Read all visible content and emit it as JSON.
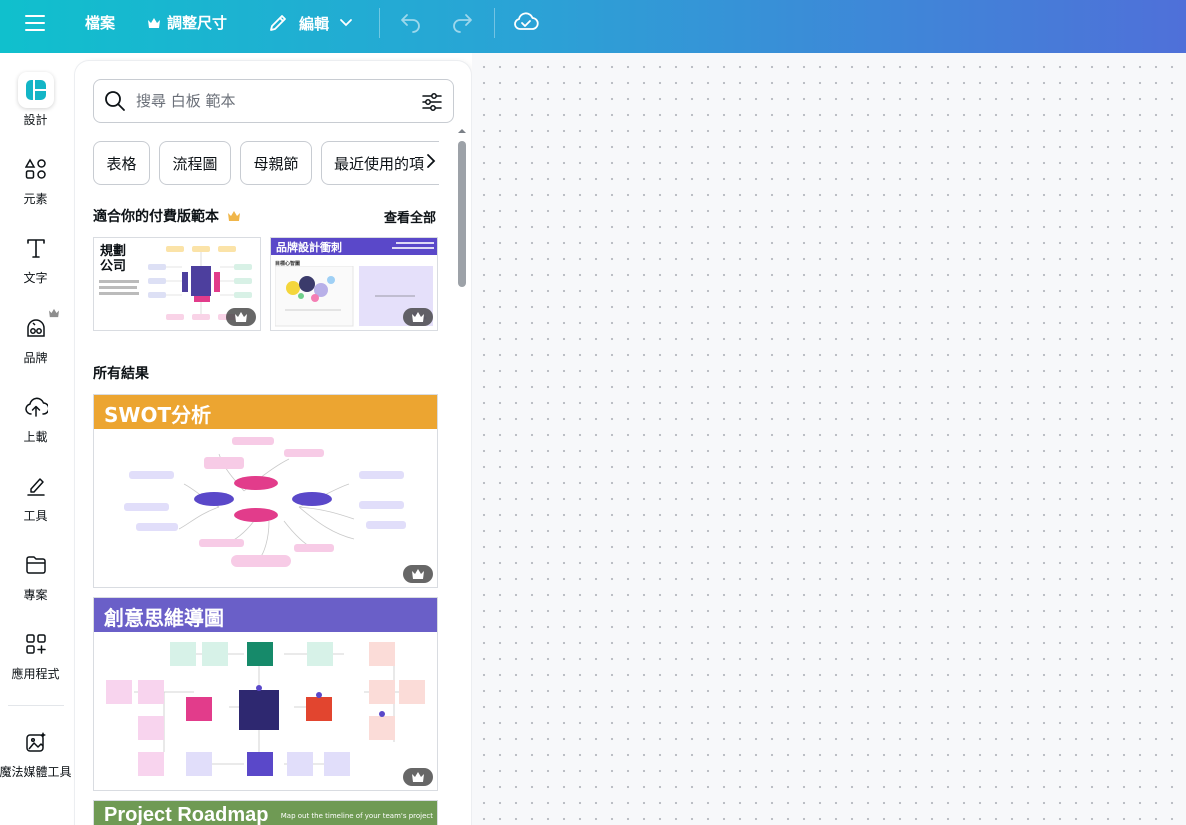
{
  "toolbar": {
    "file_label": "檔案",
    "resize_label": "調整尺寸",
    "edit_label": "編輯"
  },
  "rail": {
    "items": [
      {
        "label": "設計",
        "icon": "design-icon"
      },
      {
        "label": "元素",
        "icon": "elements-icon"
      },
      {
        "label": "文字",
        "icon": "text-icon"
      },
      {
        "label": "品牌",
        "icon": "brand-icon"
      },
      {
        "label": "上載",
        "icon": "upload-icon"
      },
      {
        "label": "工具",
        "icon": "draw-icon"
      },
      {
        "label": "專案",
        "icon": "folder-icon"
      },
      {
        "label": "應用程式",
        "icon": "apps-icon"
      },
      {
        "label": "魔法媒體工具",
        "icon": "magic-media-icon"
      }
    ]
  },
  "panel": {
    "search_placeholder": "搜尋 白板 範本",
    "chips": [
      "表格",
      "流程圖",
      "母親節",
      "最近使用的項"
    ],
    "premium_section_title": "適合你的付費版範本",
    "see_all": "查看全部",
    "all_results_title": "所有結果",
    "premium_templates": [
      {
        "title_line1": "規劃",
        "title_line2": "公司"
      },
      {
        "title": "品牌設計衝刺",
        "step_label": "目標心智圖"
      }
    ],
    "results": [
      {
        "title": "SWOT分析",
        "color": "#eca531"
      },
      {
        "title": "創意思維導圖",
        "color": "#6a5fc8"
      },
      {
        "title": "Project Roadmap",
        "subtitle": "Map out the timeline of your team's project",
        "color": "#6f9a54"
      }
    ]
  },
  "colors": {
    "brand_accent": "#10c0cd",
    "swot_orange": "#eca531",
    "mindmap_purple": "#6a5fc8",
    "roadmap_green": "#6f9a54"
  }
}
